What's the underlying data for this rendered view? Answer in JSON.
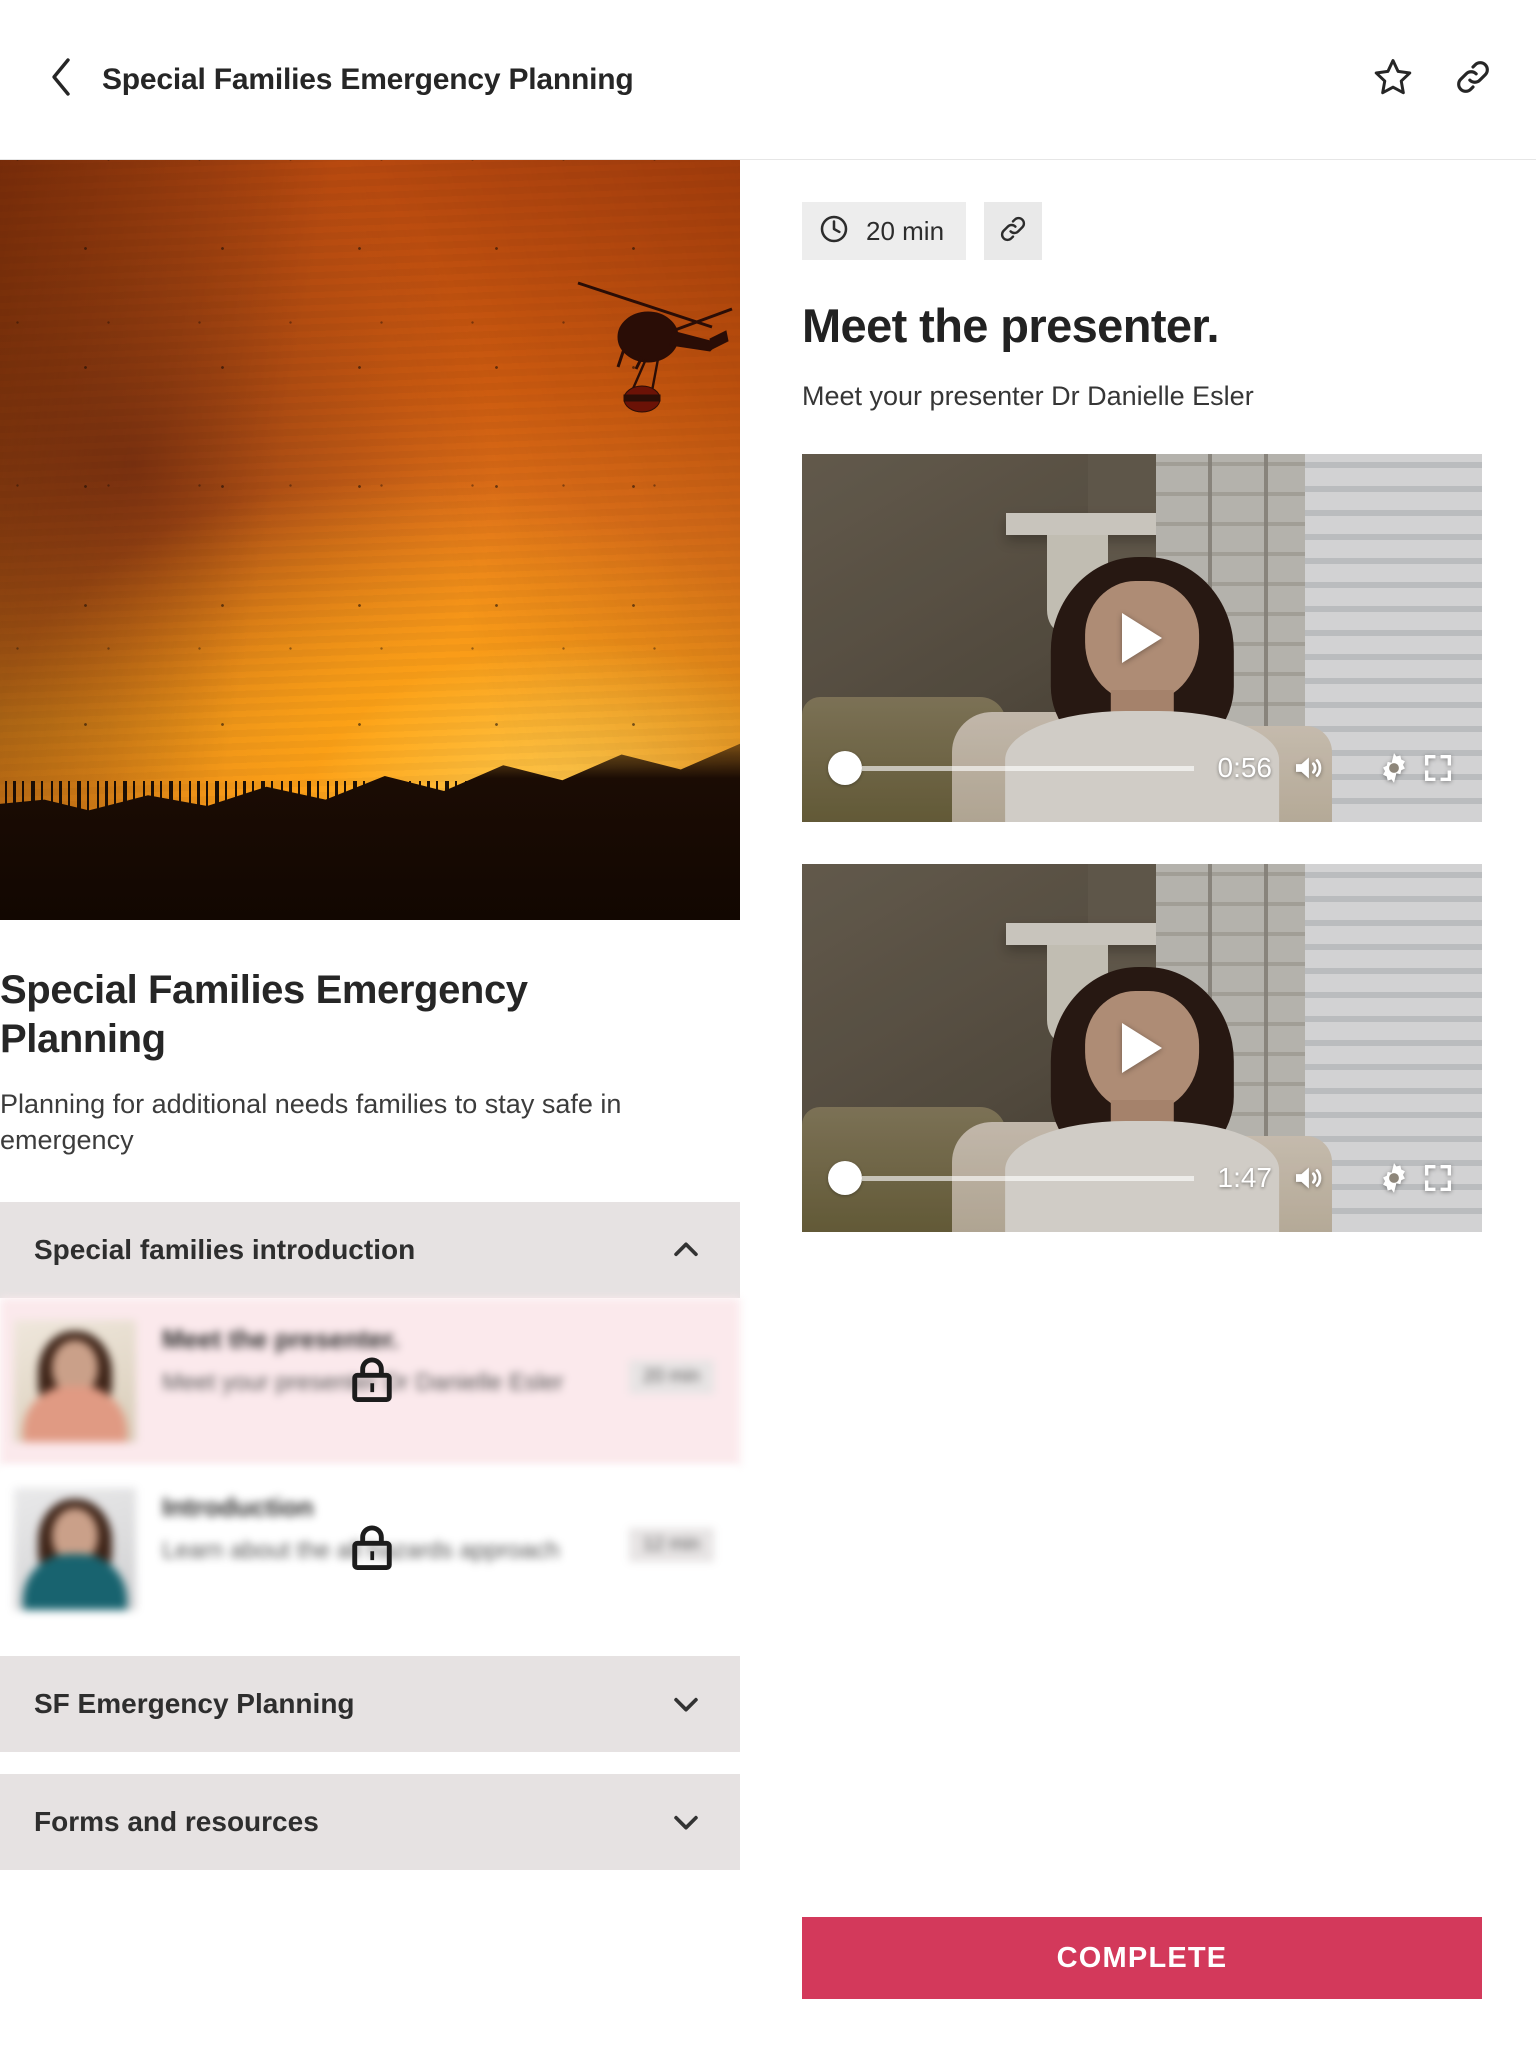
{
  "topbar": {
    "title": "Special Families Emergency Planning",
    "back_icon": "chevron-left-icon",
    "star_icon": "star-outline-icon",
    "link_icon": "link-icon"
  },
  "hero": {
    "alt": "wildfire with firefighting helicopter"
  },
  "course": {
    "title": "Special Families Emergency Planning",
    "description": "Planning for additional needs families to stay safe in emergency"
  },
  "accordion": [
    {
      "label": "Special families introduction",
      "expanded": true,
      "chevron": "chevron-up-icon",
      "lessons": [
        {
          "title": "Meet the presenter.",
          "subtitle": "Meet your presenter Dr Danielle Esler",
          "duration": "20 min",
          "locked": true,
          "active": true,
          "lock_icon": "lock-icon"
        },
        {
          "title": "Introduction",
          "subtitle": "Learn about the all hazards approach",
          "duration": "12 min",
          "locked": true,
          "active": false,
          "lock_icon": "lock-icon"
        }
      ]
    },
    {
      "label": "SF Emergency Planning",
      "expanded": false,
      "chevron": "chevron-down-icon",
      "lessons": []
    },
    {
      "label": "Forms and resources",
      "expanded": false,
      "chevron": "chevron-down-icon",
      "lessons": []
    }
  ],
  "detail": {
    "duration_badge": "20 min",
    "clock_icon": "clock-icon",
    "link_icon": "link-icon",
    "title": "Meet the presenter.",
    "subtitle": "Meet your presenter Dr Danielle Esler",
    "videos": [
      {
        "time": "0:56",
        "play_icon": "play-icon",
        "volume_icon": "volume-on-icon",
        "settings_icon": "gear-icon",
        "fullscreen_icon": "fullscreen-icon"
      },
      {
        "time": "1:47",
        "play_icon": "play-icon",
        "volume_icon": "volume-on-icon",
        "settings_icon": "gear-icon",
        "fullscreen_icon": "fullscreen-icon"
      }
    ],
    "complete_label": "COMPLETE"
  },
  "colors": {
    "accent": "#d3395b",
    "active_lesson_bg": "#fbe9ec",
    "accordion_bg": "#e6e2e2",
    "badge_bg": "#ededed"
  }
}
